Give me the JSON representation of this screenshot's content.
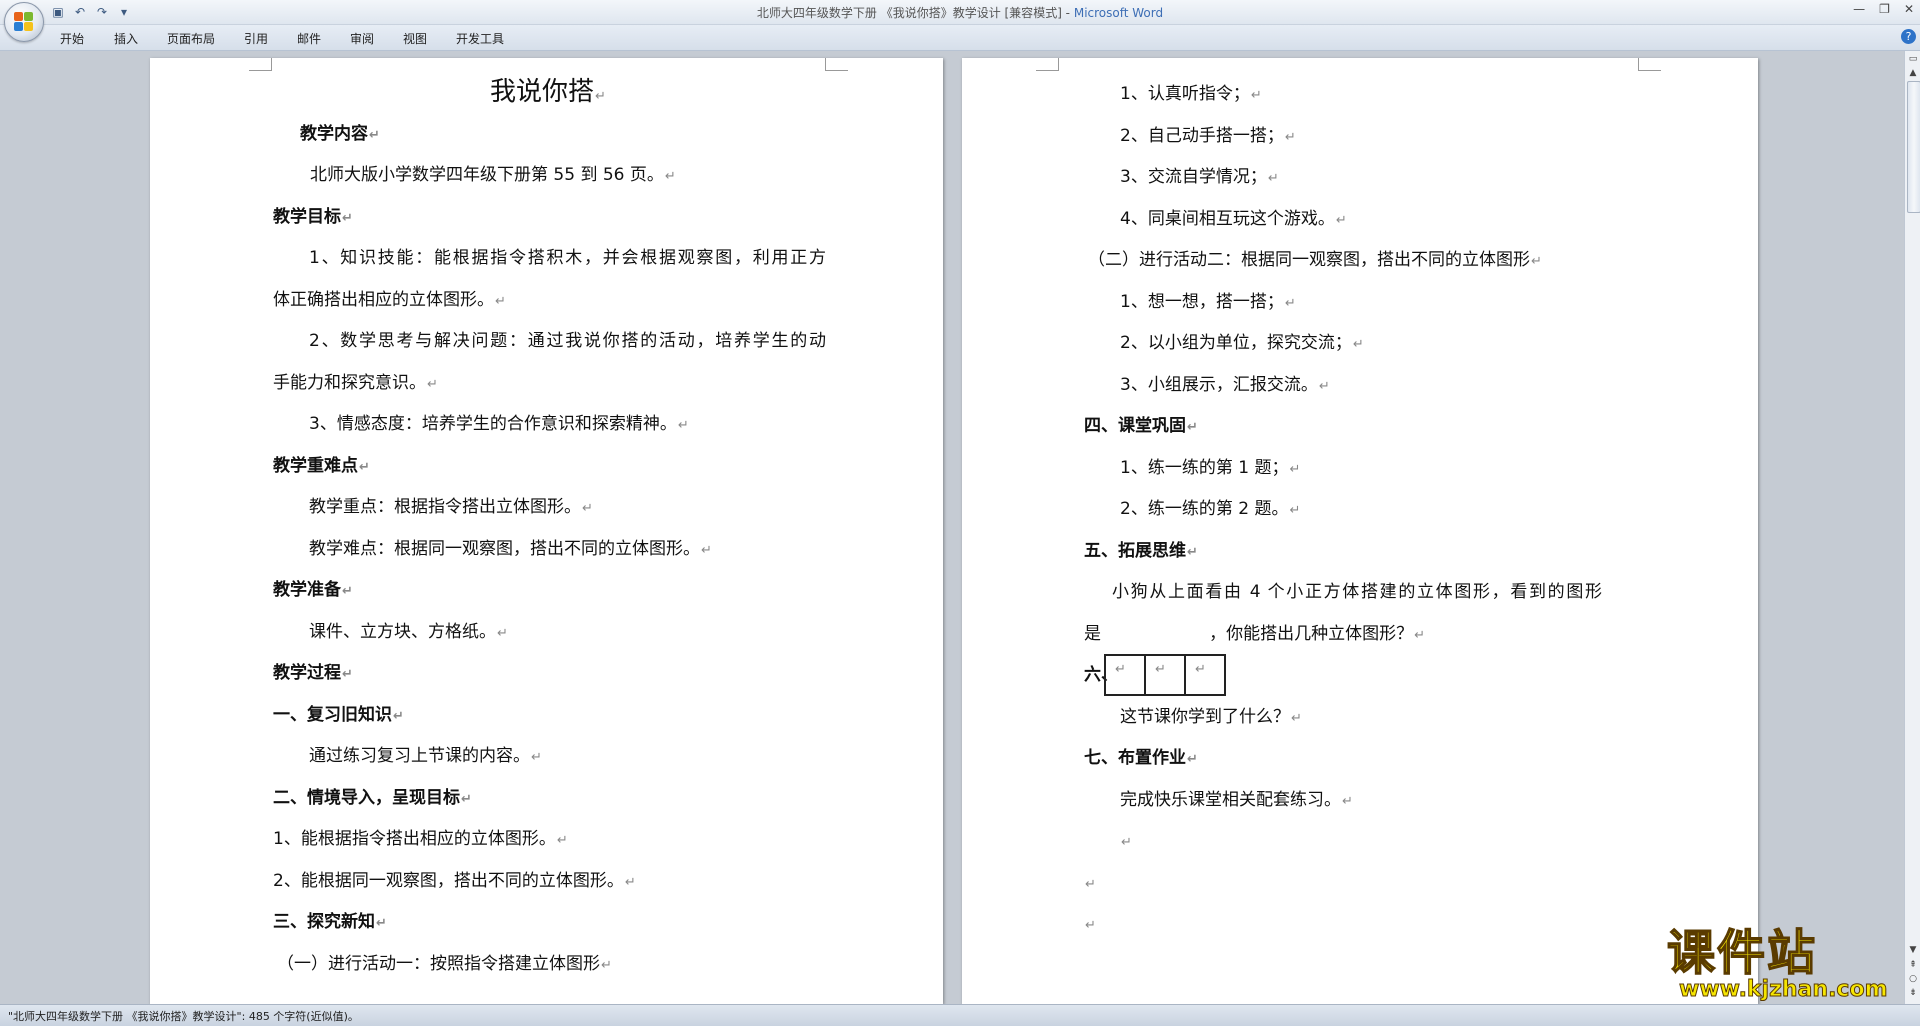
{
  "window": {
    "title": "北师大四年级数学下册 《我说你搭》教学设计 [兼容模式] - ",
    "app_name": "Microsoft Word"
  },
  "ribbon": {
    "tabs": [
      "开始",
      "插入",
      "页面布局",
      "引用",
      "邮件",
      "审阅",
      "视图",
      "开发工具"
    ]
  },
  "document": {
    "left_page": [
      {
        "text": "我说你搭",
        "style": "title"
      },
      {
        "text": "教学内容",
        "style": "b"
      },
      {
        "text": "北师大版小学数学四年级下册第 55 到 56 页。",
        "style": ""
      },
      {
        "text": "教学目标",
        "style": "b"
      },
      {
        "text": "1、知识技能：能根据指令搭积木，并会根据观察图，利用正方",
        "style": "jl"
      },
      {
        "text": "体正确搭出相应的立体图形。",
        "style": ""
      },
      {
        "text": "2、数学思考与解决问题：通过我说你搭的活动，培养学生的动",
        "style": "jl"
      },
      {
        "text": "手能力和探究意识。",
        "style": ""
      },
      {
        "text": "3、情感态度：培养学生的合作意识和探索精神。",
        "style": ""
      },
      {
        "text": "教学重难点",
        "style": "b"
      },
      {
        "text": "教学重点：根据指令搭出立体图形。",
        "style": ""
      },
      {
        "text": "教学难点：根据同一观察图，搭出不同的立体图形。",
        "style": ""
      },
      {
        "text": "教学准备",
        "style": "b"
      },
      {
        "text": "课件、立方块、方格纸。",
        "style": ""
      },
      {
        "text": "教学过程",
        "style": "b"
      },
      {
        "text": "一、复习旧知识",
        "style": "b"
      },
      {
        "text": "通过练习复习上节课的内容。",
        "style": ""
      },
      {
        "text": "二、情境导入，呈现目标",
        "style": "b"
      },
      {
        "text": "1、能根据指令搭出相应的立体图形。",
        "style": ""
      },
      {
        "text": "2、能根据同一观察图，搭出不同的立体图形。",
        "style": ""
      },
      {
        "text": "三、探究新知",
        "style": "b"
      },
      {
        "text": "（一）进行活动一：按照指令搭建立体图形",
        "style": ""
      }
    ],
    "right_page": [
      {
        "text": "1、认真听指令；",
        "style": ""
      },
      {
        "text": "2、自己动手搭一搭；",
        "style": ""
      },
      {
        "text": "3、交流自学情况；",
        "style": ""
      },
      {
        "text": "4、同桌间相互玩这个游戏。",
        "style": ""
      },
      {
        "text": "（二）进行活动二：根据同一观察图，搭出不同的立体图形",
        "style": ""
      },
      {
        "text": "1、想一想，搭一搭；",
        "style": ""
      },
      {
        "text": "2、以小组为单位，探究交流；",
        "style": ""
      },
      {
        "text": "3、小组展示，汇报交流。",
        "style": ""
      },
      {
        "text": "四、课堂巩固",
        "style": "b"
      },
      {
        "text": "1、练一练的第 1 题；",
        "style": ""
      },
      {
        "text": "2、练一练的第 2 题。",
        "style": ""
      },
      {
        "text": "五、拓展思维",
        "style": "b"
      },
      {
        "text": "小狗从上面看由  4  个小正方体搭建的立体图形，看到的图形",
        "style": "jl"
      },
      {
        "text": "是                    ，你能搭出几种立体图形？",
        "style": ""
      },
      {
        "text": "六、",
        "style": "b"
      },
      {
        "text": "这节课你学到了什么？",
        "style": ""
      },
      {
        "text": "七、布置作业",
        "style": "b"
      },
      {
        "text": "完成快乐课堂相关配套练习。",
        "style": ""
      },
      {
        "text": "",
        "style": ""
      },
      {
        "text": "",
        "style": ""
      },
      {
        "text": "",
        "style": ""
      }
    ],
    "paragraph_mark": "↵"
  },
  "status": {
    "text": "\"北师大四年级数学下册 《我说你搭》教学设计\": 485 个字符(近似值)。"
  },
  "watermark": {
    "big": "课件站",
    "small": "www.kjzhan.com"
  },
  "colors": {
    "workspace": "#c5cbd3",
    "app_title_blue": "#3d6eb5",
    "watermark_yellow": "#f6e600"
  }
}
